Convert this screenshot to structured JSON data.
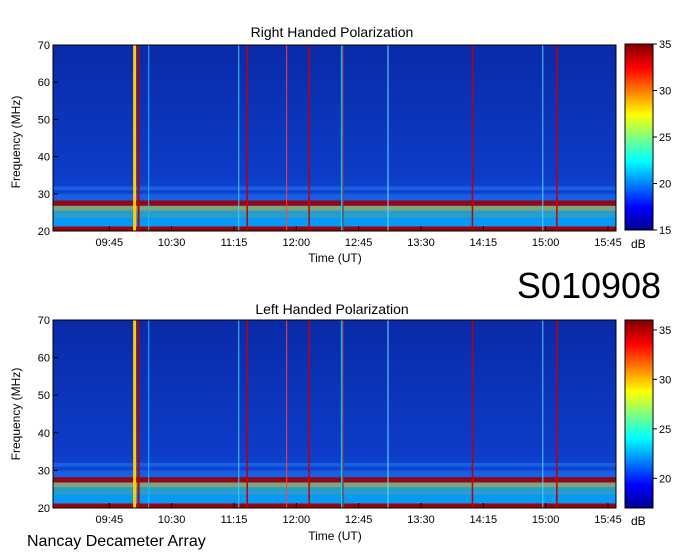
{
  "station_id": "S010908",
  "footer": "Nancay Decameter Array",
  "colors": {
    "background": "#0a2fb8",
    "band": "#a00000",
    "frame": "#000000"
  },
  "chart_data": [
    {
      "type": "heatmap",
      "title": "Right Handed Polarization",
      "xlabel": "Time (UT)",
      "ylabel": "Frequency (MHz)",
      "x_ticks": [
        "09:45",
        "10:30",
        "11:15",
        "12:00",
        "12:45",
        "13:30",
        "14:15",
        "15:00",
        "15:45"
      ],
      "y_ticks": [
        "20",
        "30",
        "40",
        "50",
        "60",
        "70"
      ],
      "ylim": [
        20,
        70
      ],
      "colorbar": {
        "unit": "dB",
        "ticks": [
          "15",
          "20",
          "25",
          "30",
          "35"
        ],
        "range": [
          15,
          35
        ]
      }
    },
    {
      "type": "heatmap",
      "title": "Left Handed Polarization",
      "xlabel": "Time (UT)",
      "ylabel": "Frequency (MHz)",
      "x_ticks": [
        "09:45",
        "10:30",
        "11:15",
        "12:00",
        "12:45",
        "13:30",
        "14:15",
        "15:00",
        "15:45"
      ],
      "y_ticks": [
        "20",
        "30",
        "40",
        "50",
        "60",
        "70"
      ],
      "ylim": [
        20,
        70
      ],
      "colorbar": {
        "unit": "dB",
        "ticks": [
          "20",
          "25",
          "30",
          "35"
        ],
        "range": [
          17,
          36
        ]
      }
    }
  ]
}
